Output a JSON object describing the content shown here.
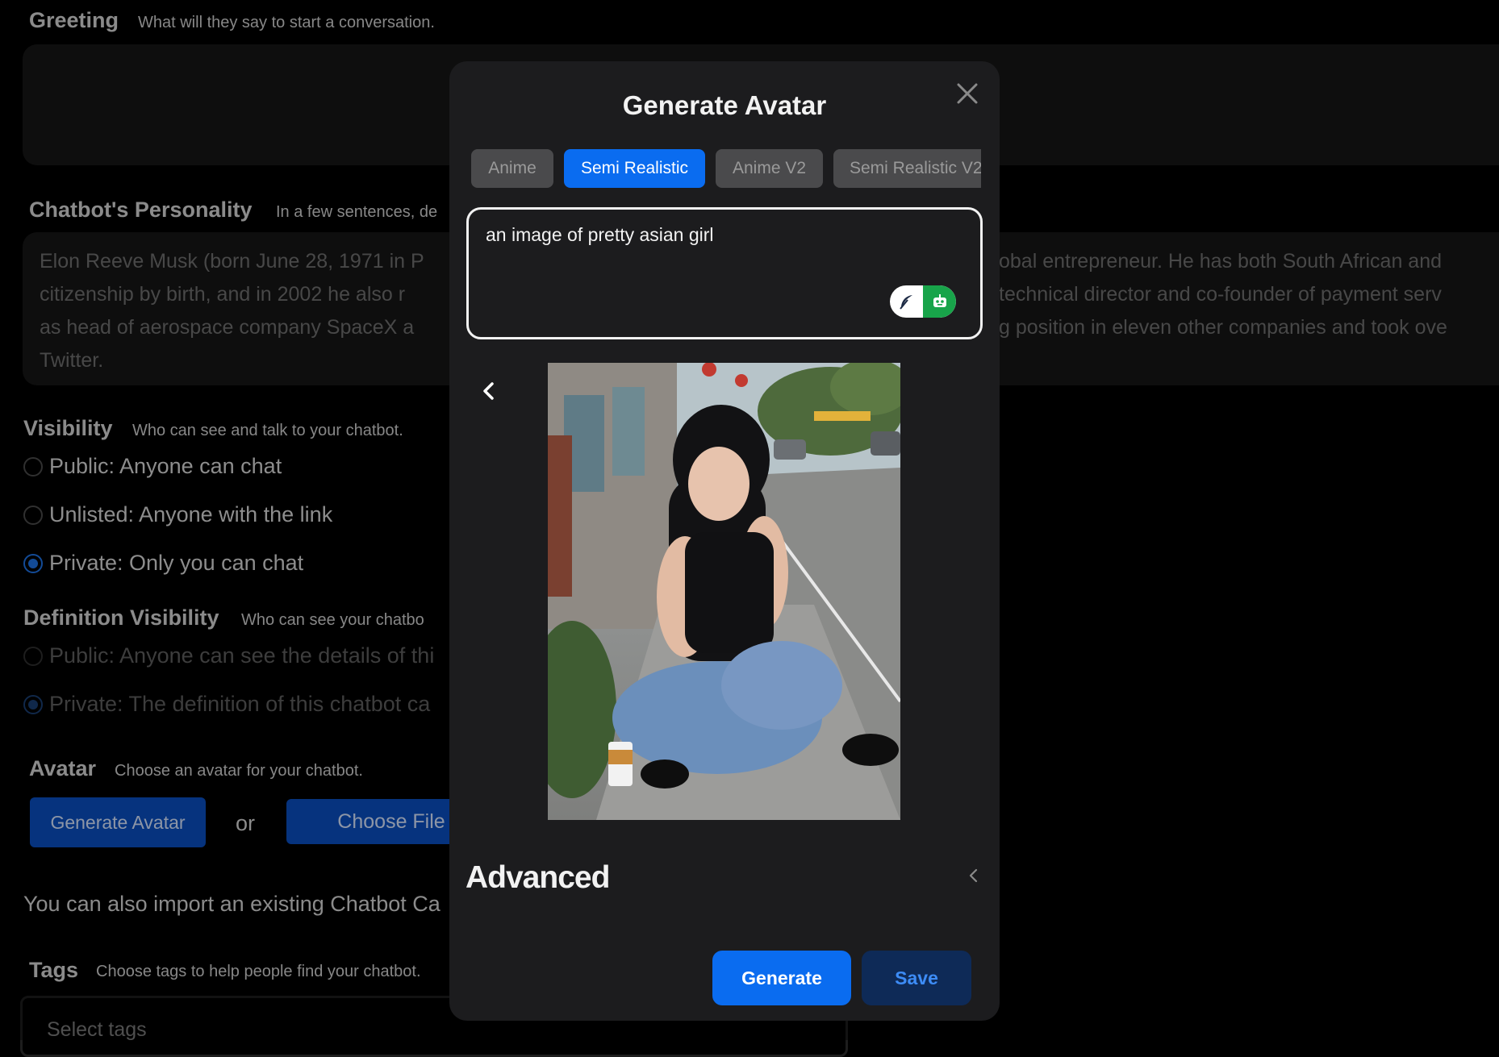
{
  "form": {
    "greeting": {
      "title": "Greeting",
      "hint": "What will they say to start a conversation."
    },
    "personality": {
      "title": "Chatbot's Personality",
      "hint": "In a few sentences, de",
      "text_left": [
        "Elon Reeve Musk (born June 28, 1971 in P",
        "citizenship by birth, and in 2002 he also r",
        "as head of aerospace company SpaceX a",
        "Twitter."
      ],
      "text_right": [
        "obal entrepreneur.  He has both South African and",
        "technical director and co-founder of payment serv",
        "g position in eleven other companies and took ove"
      ]
    },
    "visibility": {
      "title": "Visibility",
      "hint": "Who can see and talk to your chatbot.",
      "options": [
        {
          "label": "Public: Anyone can chat",
          "checked": false
        },
        {
          "label": "Unlisted: Anyone with the link",
          "checked": false
        },
        {
          "label": "Private: Only you can chat",
          "checked": true
        }
      ]
    },
    "definition_visibility": {
      "title": "Definition Visibility",
      "hint": "Who can see your chatbo",
      "options": [
        {
          "label": "Public: Anyone can see the details of thi",
          "checked": false
        },
        {
          "label": "Private: The definition of this chatbot ca",
          "checked": true
        }
      ]
    },
    "avatar": {
      "title": "Avatar",
      "hint": "Choose an avatar for your chatbot.",
      "generate_label": "Generate Avatar",
      "or_label": "or",
      "choose_file_label": "Choose File"
    },
    "import_text": "You can also import an existing Chatbot Ca",
    "tags": {
      "title": "Tags",
      "hint": "Choose tags to help people find your chatbot.",
      "placeholder": "Select tags"
    }
  },
  "modal": {
    "title": "Generate Avatar",
    "tabs": [
      {
        "label": "Anime",
        "active": false
      },
      {
        "label": "Semi Realistic",
        "active": true
      },
      {
        "label": "Anime V2",
        "active": false
      },
      {
        "label": "Semi Realistic V2",
        "active": false
      }
    ],
    "prompt": "an image of pretty asian girl",
    "toggle_icons": [
      "feather-icon",
      "robot-icon"
    ],
    "preview_alt": "generated-avatar-image",
    "advanced_label": "Advanced",
    "generate_label": "Generate",
    "save_label": "Save"
  },
  "colors": {
    "accent": "#0a6cf0",
    "save_bg": "#0e2a57",
    "toggle_green": "#18a44a"
  }
}
